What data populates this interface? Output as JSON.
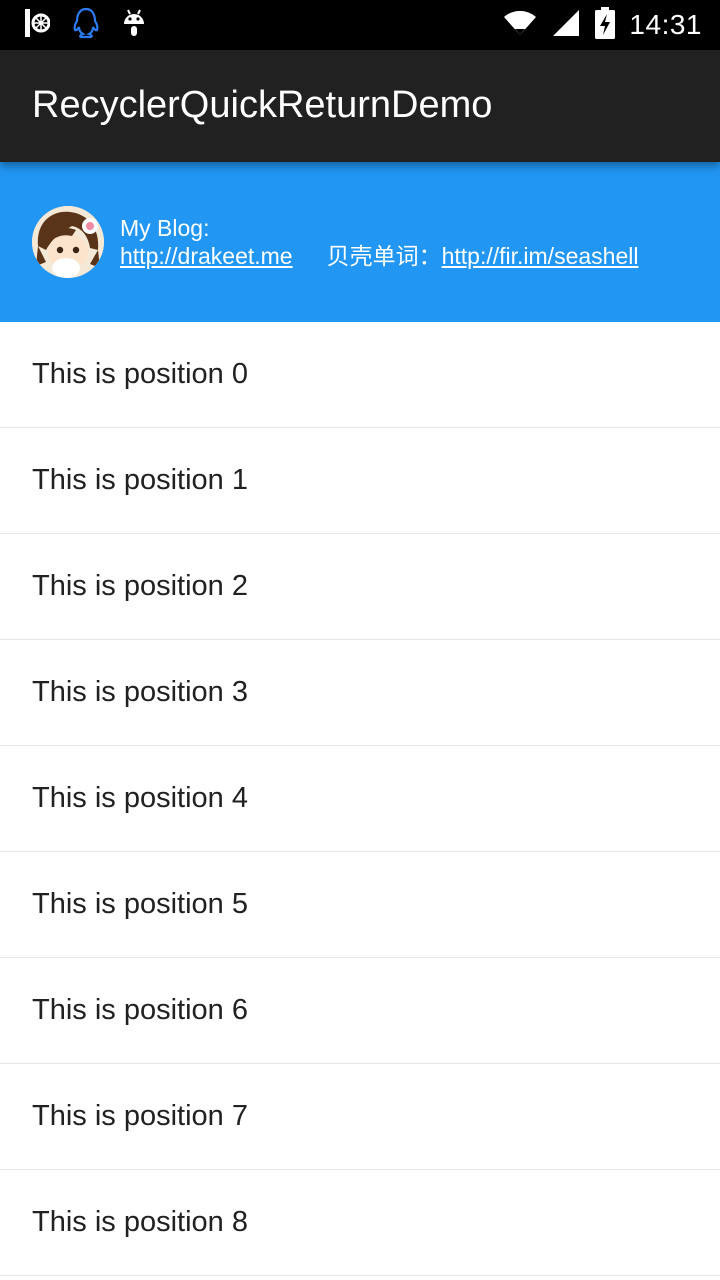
{
  "status_bar": {
    "time": "14:31",
    "left_icons": [
      "grid-notification-icon",
      "qq-icon",
      "android-icon"
    ],
    "right_icons": [
      "wifi-icon",
      "cell-signal-icon",
      "battery-charging-icon"
    ]
  },
  "app_bar": {
    "title": "RecyclerQuickReturnDemo",
    "background": "#212121"
  },
  "banner": {
    "background": "#2196f3",
    "blog_label": "My Blog:",
    "blog_link": "http://drakeet.me",
    "app_name": "贝壳单词：",
    "app_link": "http://fir.im/seashell"
  },
  "list": {
    "items": [
      "This is position 0",
      "This is position 1",
      "This is position 2",
      "This is position 3",
      "This is position 4",
      "This is position 5",
      "This is position 6",
      "This is position 7",
      "This is position 8"
    ]
  }
}
